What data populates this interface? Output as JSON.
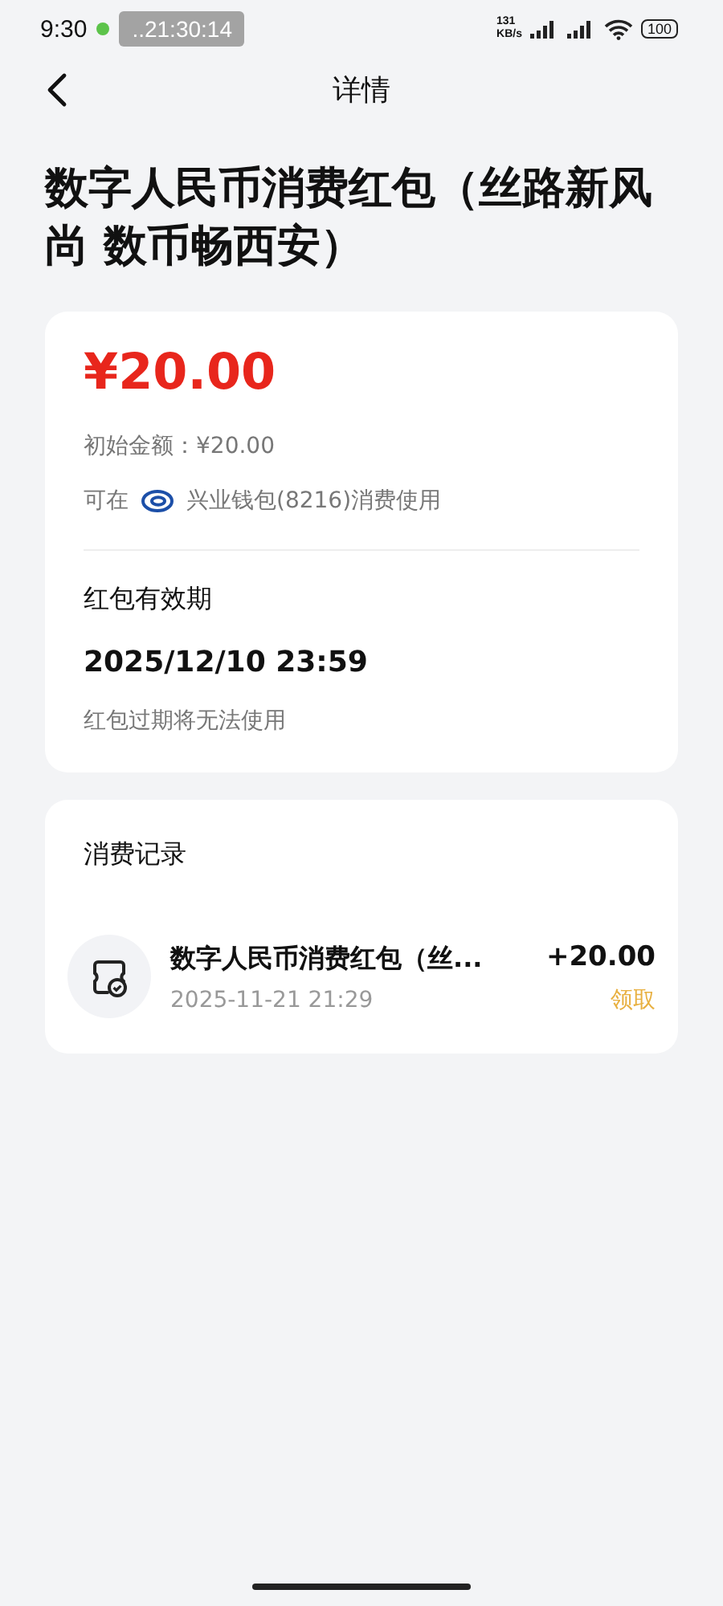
{
  "status_bar": {
    "time": "9:30",
    "overlay_clock": "..21:30:14",
    "network_speed": [
      "131",
      "KB/s"
    ],
    "battery": "100"
  },
  "nav": {
    "title": "详情"
  },
  "title": "数字人民币消费红包（丝路新风尚 数币畅西安）",
  "summary": {
    "amount": "¥20.00",
    "initial_amount": "初始金额：¥20.00",
    "usable_prefix": "可在",
    "usable_wallet": "兴业钱包(8216)消费使用",
    "validity_label": "红包有效期",
    "validity_date": "2025/12/10 23:59",
    "validity_note": "红包过期将无法使用"
  },
  "records": {
    "title": "消费记录",
    "items": [
      {
        "name": "数字人民币消费红包（丝...",
        "time": "2025-11-21 21:29",
        "amount": "+20.00",
        "type": "领取"
      }
    ]
  }
}
